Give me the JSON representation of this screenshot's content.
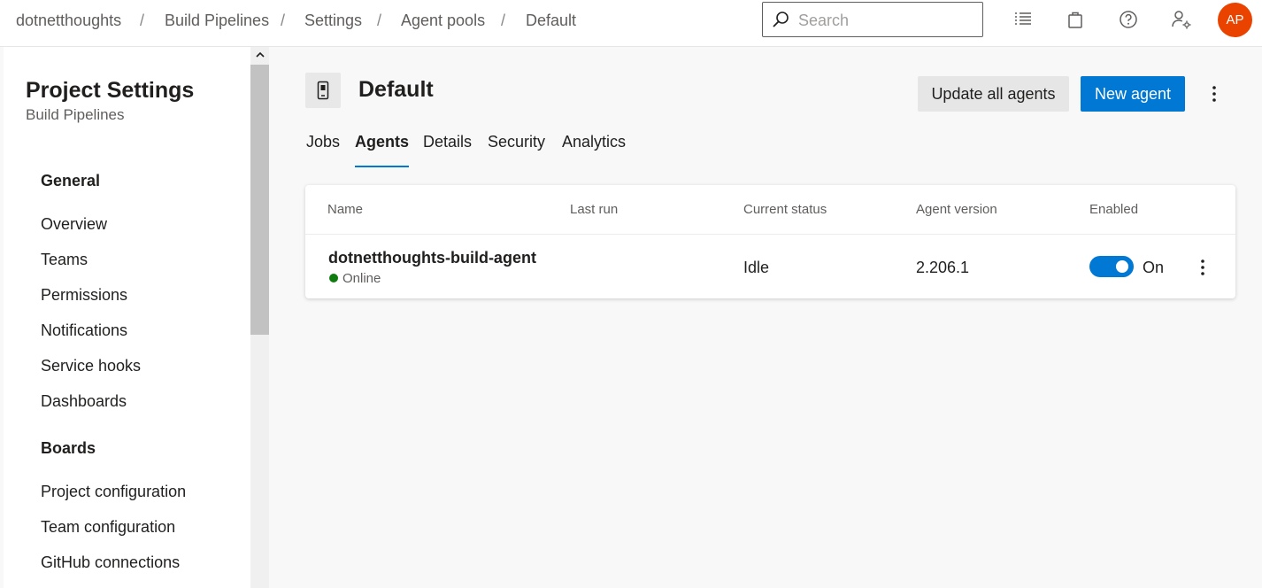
{
  "breadcrumb": {
    "items": [
      "dotnetthoughts",
      "Build Pipelines",
      "Settings",
      "Agent pools",
      "Default"
    ],
    "separator": "/"
  },
  "search": {
    "placeholder": "Search"
  },
  "header_icons": [
    "task-list-icon",
    "shopping-bag-icon",
    "help-icon",
    "user-settings-icon"
  ],
  "user": {
    "initials": "AP",
    "avatar_color": "#ea4300"
  },
  "sidebar": {
    "title": "Project Settings",
    "subtitle": "Build Pipelines",
    "sections": [
      {
        "label": "General",
        "items": [
          "Overview",
          "Teams",
          "Permissions",
          "Notifications",
          "Service hooks",
          "Dashboards"
        ]
      },
      {
        "label": "Boards",
        "items": [
          "Project configuration",
          "Team configuration",
          "GitHub connections"
        ]
      }
    ]
  },
  "pool": {
    "title": "Default",
    "update_button": "Update all agents",
    "new_button": "New agent"
  },
  "tabs": [
    {
      "label": "Jobs",
      "active": false
    },
    {
      "label": "Agents",
      "active": true
    },
    {
      "label": "Details",
      "active": false
    },
    {
      "label": "Security",
      "active": false
    },
    {
      "label": "Analytics",
      "active": false
    }
  ],
  "table": {
    "columns": [
      "Name",
      "Last run",
      "Current status",
      "Agent version",
      "Enabled"
    ],
    "rows": [
      {
        "name": "dotnetthoughts-build-agent",
        "online_status": "Online",
        "last_run": "",
        "current_status": "Idle",
        "agent_version": "2.206.1",
        "enabled": true,
        "enabled_label": "On"
      }
    ]
  },
  "colors": {
    "accent": "#0078d4",
    "online": "#107c10"
  }
}
